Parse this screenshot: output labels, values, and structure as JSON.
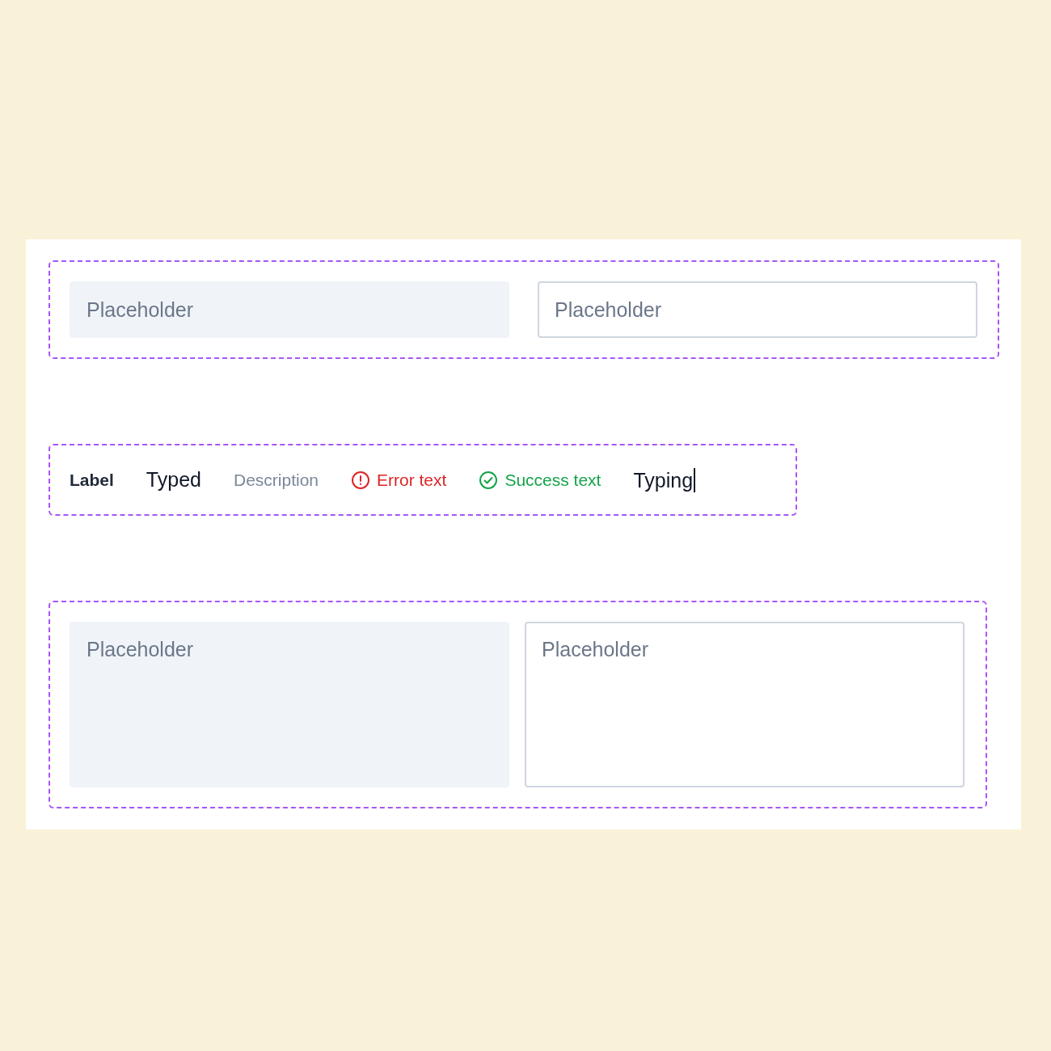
{
  "inputs": [
    {
      "kind": "filled",
      "placeholder": "Placeholder"
    },
    {
      "kind": "outlined",
      "placeholder": "Placeholder"
    }
  ],
  "texts": [
    {
      "kind": "label",
      "text": "Label"
    },
    {
      "kind": "typed",
      "text": "Typed"
    },
    {
      "kind": "description",
      "text": "Description"
    },
    {
      "kind": "error",
      "text": "Error text"
    },
    {
      "kind": "success",
      "text": "Success text"
    },
    {
      "kind": "typing",
      "text": "Typing"
    }
  ],
  "textareas": [
    {
      "kind": "filled",
      "placeholder": "Placeholder"
    },
    {
      "kind": "outlined",
      "placeholder": "Placeholder"
    }
  ]
}
